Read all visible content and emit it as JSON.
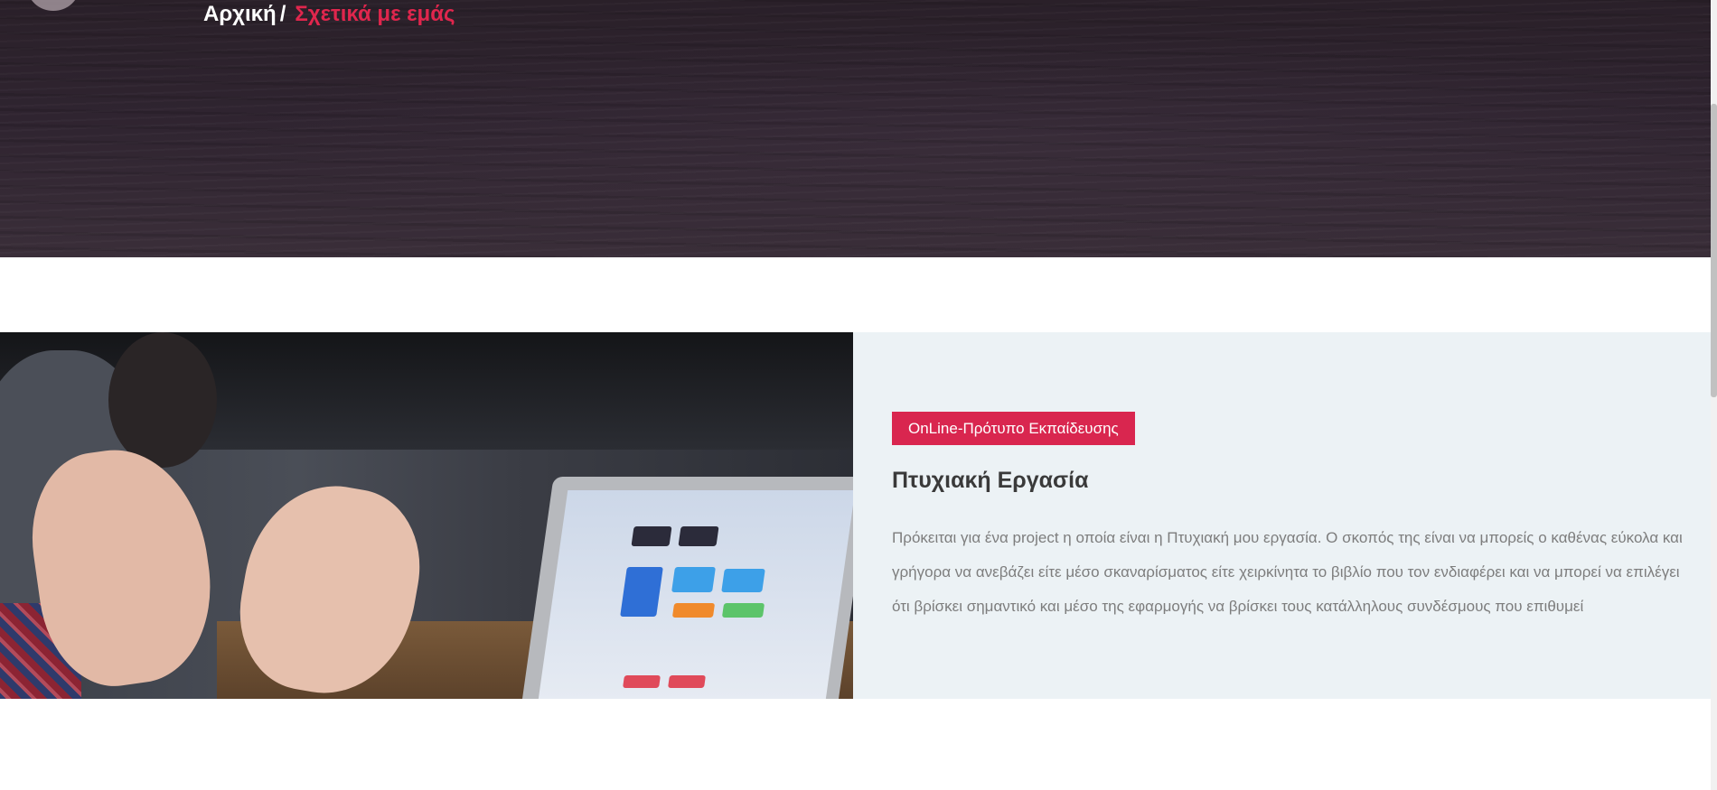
{
  "breadcrumb": {
    "home": "Αρχική",
    "separator": "/",
    "current": "Σχετικά με εμάς"
  },
  "about": {
    "tag": "OnLine-Πρότυπο Εκπαίδευσης",
    "title": "Πτυχιακή Εργασία",
    "description": "Πρόκειται για ένα project η οποία είναι η Πτυχιακή μου εργασία. Ο σκοπός της είναι να μπορείς ο καθένας εύκολα και γρήγορα να ανεβάζει είτε μέσο σκαναρίσματος είτε χειρκίνητα το βιβλίο που τον ενδιαφέρει και να μπορεί να επιλέγει ότι βρίσκει σημαντικό και μέσο της εφαρμογής να βρίσκει τους κατάλληλους συνδέσμους που επιθυμεί"
  },
  "colors": {
    "accent": "#d9264f",
    "hero_background": "#2f2430",
    "section_background": "#ecf2f5"
  }
}
